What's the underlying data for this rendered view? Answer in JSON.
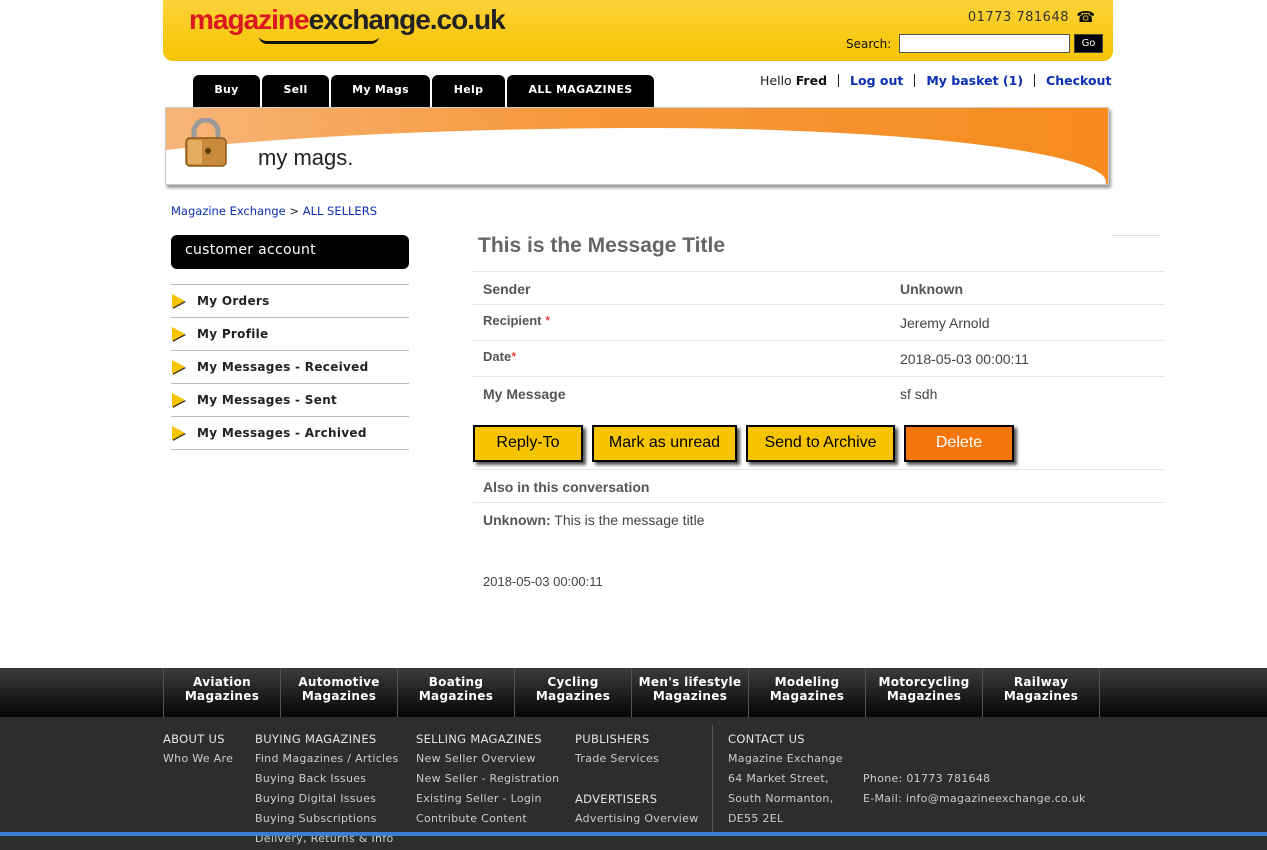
{
  "header": {
    "logo_part1": "magazine",
    "logo_part2": "exchange.co.uk",
    "phone": "01773 781648",
    "search_label": "Search:",
    "go_label": "Go"
  },
  "tabs": [
    {
      "label": "Buy"
    },
    {
      "label": "Sell"
    },
    {
      "label": "My Mags"
    },
    {
      "label": "Help"
    },
    {
      "label": "ALL MAGAZINES"
    }
  ],
  "userbar": {
    "hello": "Hello",
    "name": "Fred",
    "logout": "Log out",
    "basket": "My basket (1)",
    "checkout": "Checkout"
  },
  "banner": {
    "title": "my mags."
  },
  "breadcrumb": {
    "home": "Magazine Exchange",
    "sep": ">",
    "current": "ALL SELLERS"
  },
  "sidebar": {
    "heading": "customer account",
    "items": [
      {
        "label": "My Orders"
      },
      {
        "label": "My Profile"
      },
      {
        "label": "My Messages - Received"
      },
      {
        "label": "My Messages - Sent"
      },
      {
        "label": "My Messages - Archived"
      }
    ]
  },
  "message": {
    "title": "This is the Message Title",
    "sender_label": "Sender",
    "sender_value": "Unknown",
    "recipient_label": "Recipient",
    "recipient_value": "Jeremy Arnold",
    "date_label": "Date",
    "date_value": "2018-05-03 00:00:11",
    "body_label": "My Message",
    "body_value": "sf sdh",
    "required_mark": "*"
  },
  "actions": {
    "reply": "Reply-To",
    "unread": "Mark as unread",
    "archive": "Send to Archive",
    "delete": "Delete"
  },
  "conversation": {
    "heading": "Also in this conversation",
    "author": "Unknown:",
    "text": "This is the message title",
    "date": "2018-05-03 00:00:11"
  },
  "categories": [
    {
      "line1": "Aviation",
      "line2": "Magazines"
    },
    {
      "line1": "Automotive",
      "line2": "Magazines"
    },
    {
      "line1": "Boating",
      "line2": "Magazines"
    },
    {
      "line1": "Cycling",
      "line2": "Magazines"
    },
    {
      "line1": "Men's lifestyle",
      "line2": "Magazines"
    },
    {
      "line1": "Modeling",
      "line2": "Magazines"
    },
    {
      "line1": "Motorcycling",
      "line2": "Magazines"
    },
    {
      "line1": "Railway",
      "line2": "Magazines"
    }
  ],
  "footer": {
    "about": {
      "heading": "ABOUT US",
      "links": [
        "Who We Are"
      ]
    },
    "buying": {
      "heading": "BUYING MAGAZINES",
      "links": [
        "Find Magazines / Articles",
        "Buying Back Issues",
        "Buying Digital Issues",
        "Buying Subscriptions",
        "Delivery, Returns & Info"
      ]
    },
    "selling": {
      "heading": "SELLING MAGAZINES",
      "links": [
        "New Seller Overview",
        "New Seller - Registration",
        "Existing Seller - Login",
        "Contribute Content"
      ]
    },
    "publishers": {
      "heading": "PUBLISHERS",
      "links": [
        "Trade Services"
      ]
    },
    "advertisers": {
      "heading": "ADVERTISERS",
      "links": [
        "Advertising Overview"
      ]
    },
    "contact": {
      "heading": "CONTACT US",
      "lines": [
        "Magazine Exchange",
        "64 Market Street,",
        "South Normanton,",
        "DE55 2EL"
      ]
    },
    "phone": "Phone: 01773 781648",
    "email": "E-Mail: info@magazineexchange.co.uk"
  },
  "colors": {
    "brand_yellow": "#f6c400",
    "delete_orange": "#f5760c",
    "link_blue": "#0a2fb0"
  }
}
